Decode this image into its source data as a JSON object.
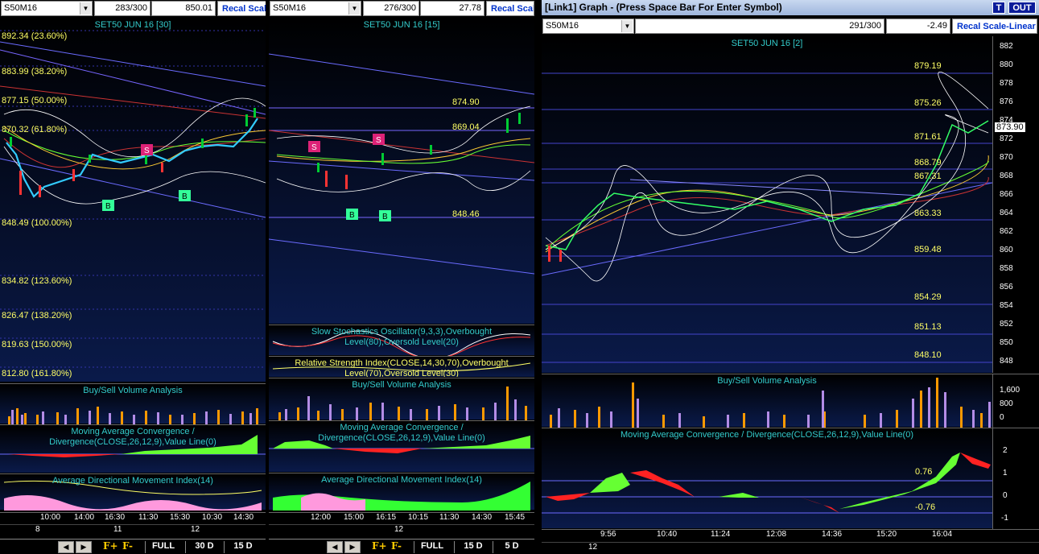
{
  "panels": [
    {
      "symbol": "S50M16",
      "count": "283/300",
      "value": "850.01",
      "recal": "Recal Scale",
      "chart_title": "SET50 JUN 16  [30]",
      "fib_levels": [
        "892.34 (23.60%)",
        "883.99 (38.20%)",
        "877.15 (50.00%)",
        "870.32 (61.80%)",
        "848.49 (100.00%)",
        "834.82 (123.60%)",
        "826.47 (138.20%)",
        "819.63 (150.00%)",
        "812.80 (161.80%)"
      ],
      "volume_title": "Buy/Sell Volume Analysis",
      "macd_title": "Moving Average Convergence / Divergence(CLOSE,26,12,9),Value Line(0)",
      "adx_title": "Average Directional Movement Index(14)",
      "times": [
        "10:00",
        "14:00",
        "16:30",
        "11:30",
        "15:30",
        "10:30",
        "14:30"
      ],
      "dates": [
        "8",
        "11",
        "12"
      ],
      "footer": [
        "FULL",
        "30 D",
        "15 D"
      ]
    },
    {
      "symbol": "S50M16",
      "count": "276/300",
      "value": "27.78",
      "recal": "Recal Scale",
      "chart_title": "SET50 JUN 16  [15]",
      "levels": [
        "874.90",
        "869.04",
        "848.46"
      ],
      "stoch_title": "Slow Stochastics Oscillator(9,3,3),Overbought Level(80),Oversold Level(20)",
      "rsi_title": "Relative Strength Index(CLOSE,14,30,70),Overbought Level(70),Oversold Level(30)",
      "volume_title": "Buy/Sell Volume Analysis",
      "macd_title": "Moving Average Convergence / Divergence(CLOSE,26,12,9),Value Line(0)",
      "adx_title": "Average Directional Movement Index(14)",
      "times": [
        "12:00",
        "15:00",
        "16:15",
        "10:15",
        "11:30",
        "14:30",
        "15:45"
      ],
      "dates": [
        "12"
      ],
      "footer": [
        "FULL",
        "15 D",
        "5 D"
      ]
    },
    {
      "window_title": "[Link1] Graph  - (Press Space Bar For Enter Symbol)",
      "btn_t": "T",
      "btn_out": "OUT",
      "symbol": "S50M16",
      "count": "291/300",
      "value": "-2.49",
      "recal": "Recal Scale-Linear",
      "chart_title": "SET50 JUN 16  [2]",
      "levels": [
        "879.19",
        "875.26",
        "871.61",
        "868.79",
        "867.31",
        "863.33",
        "859.48",
        "854.29",
        "851.13",
        "848.10"
      ],
      "price_axis": [
        "882",
        "880",
        "878",
        "876",
        "874",
        "872",
        "870",
        "868",
        "866",
        "864",
        "862",
        "860",
        "858",
        "856",
        "854",
        "852",
        "850",
        "848"
      ],
      "last_price": "873.90",
      "volume_title": "Buy/Sell Volume Analysis",
      "volume_axis": [
        "1,600",
        "800",
        "0"
      ],
      "macd_title": "Moving Average Convergence / Divergence(CLOSE,26,12,9),Value Line(0)",
      "macd_axis": [
        "2",
        "1",
        "0",
        "-1"
      ],
      "macd_levels": [
        "0.76",
        "-0.76"
      ],
      "times": [
        "9:56",
        "10:40",
        "11:24",
        "12:08",
        "14:36",
        "15:20",
        "16:04"
      ],
      "dates": [
        "12"
      ]
    }
  ],
  "colors": {
    "panel_bg": "#0a1a4a",
    "buy": "#ff9900",
    "sell": "#b38ce6",
    "macd_pos": "#66ff33",
    "macd_neg": "#ff2222",
    "level_line": "#6b6bff"
  }
}
